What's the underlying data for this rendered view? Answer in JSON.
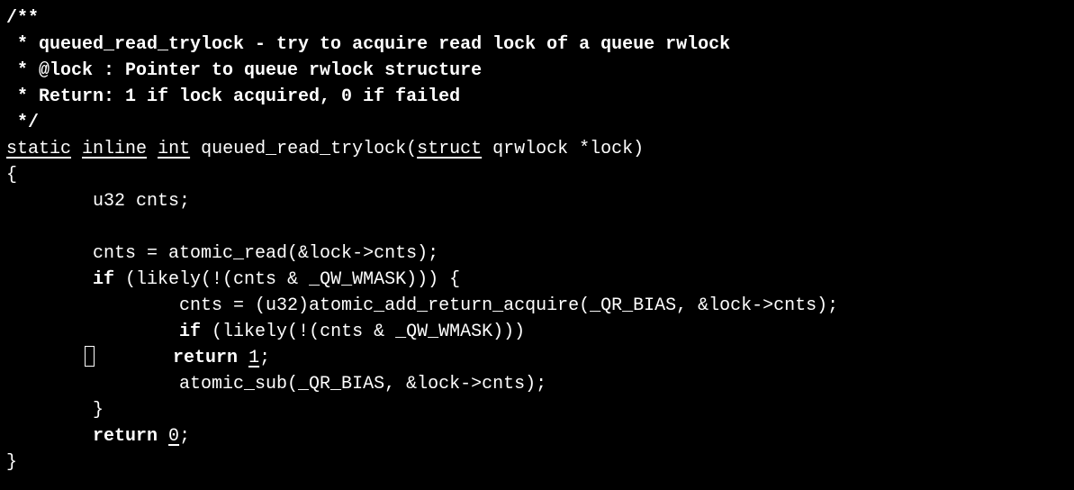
{
  "editor": {
    "lines": [
      {
        "segments": [
          {
            "text": "/**",
            "style": "comment"
          }
        ]
      },
      {
        "segments": [
          {
            "text": " * queued_read_trylock - try to acquire read lock of a queue rwlock",
            "style": "comment"
          }
        ]
      },
      {
        "segments": [
          {
            "text": " * @lock : Pointer to queue rwlock structure",
            "style": "comment"
          }
        ]
      },
      {
        "segments": [
          {
            "text": " * Return: 1 if lock acquired, 0 if failed",
            "style": "comment"
          }
        ]
      },
      {
        "segments": [
          {
            "text": " */",
            "style": "comment"
          }
        ]
      },
      {
        "segments": [
          {
            "text": "static",
            "style": "kw-u"
          },
          {
            "text": " ",
            "style": "plain"
          },
          {
            "text": "inline",
            "style": "kw-u"
          },
          {
            "text": " ",
            "style": "plain"
          },
          {
            "text": "int",
            "style": "kw-u"
          },
          {
            "text": " queued_read_trylock(",
            "style": "plain"
          },
          {
            "text": "struct",
            "style": "kw-u"
          },
          {
            "text": " qrwlock *lock)",
            "style": "plain"
          }
        ]
      },
      {
        "segments": [
          {
            "text": "{",
            "style": "plain"
          }
        ]
      },
      {
        "segments": [
          {
            "text": "        u32 cnts;",
            "style": "plain"
          }
        ]
      },
      {
        "segments": [
          {
            "text": "",
            "style": "plain"
          }
        ]
      },
      {
        "segments": [
          {
            "text": "        cnts = atomic_read(&lock->cnts);",
            "style": "plain"
          }
        ]
      },
      {
        "segments": [
          {
            "text": "        ",
            "style": "plain"
          },
          {
            "text": "if",
            "style": "kw-b"
          },
          {
            "text": " (likely(!(cnts & _QW_WMASK))) {",
            "style": "plain"
          }
        ]
      },
      {
        "segments": [
          {
            "text": "                cnts = (u32)atomic_add_return_acquire(_QR_BIAS, &lock->cnts);",
            "style": "plain"
          }
        ]
      },
      {
        "segments": [
          {
            "text": "                ",
            "style": "plain"
          },
          {
            "text": "if",
            "style": "kw-b"
          },
          {
            "text": " (likely(!(cnts & _QW_WMASK)))",
            "style": "plain"
          }
        ]
      },
      {
        "cursor_line": true,
        "segments": [
          {
            "text": "       ",
            "style": "plain"
          },
          {
            "text": "",
            "style": "cursor"
          },
          {
            "text": "       ",
            "style": "plain"
          },
          {
            "text": "return",
            "style": "kw-b"
          },
          {
            "text": " ",
            "style": "plain"
          },
          {
            "text": "1",
            "style": "num-u"
          },
          {
            "text": ";",
            "style": "plain"
          }
        ]
      },
      {
        "segments": [
          {
            "text": "                atomic_sub(_QR_BIAS, &lock->cnts);",
            "style": "plain"
          }
        ]
      },
      {
        "segments": [
          {
            "text": "        }",
            "style": "plain"
          }
        ]
      },
      {
        "segments": [
          {
            "text": "        ",
            "style": "plain"
          },
          {
            "text": "return",
            "style": "kw-b"
          },
          {
            "text": " ",
            "style": "plain"
          },
          {
            "text": "0",
            "style": "num-u"
          },
          {
            "text": ";",
            "style": "plain"
          }
        ]
      },
      {
        "segments": [
          {
            "text": "}",
            "style": "plain"
          }
        ]
      }
    ]
  },
  "colors": {
    "background": "#000000",
    "foreground": "#ffffff"
  }
}
